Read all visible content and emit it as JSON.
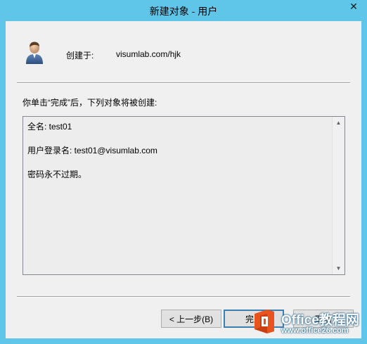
{
  "window": {
    "title": "新建对象 - 用户",
    "close_glyph": "✕"
  },
  "header": {
    "created_in_label": "创建于:",
    "created_in_value": "visumlab.com/hjk",
    "icon": "user-icon"
  },
  "summary": {
    "instruction": "你单击“完成”后，下列对象将被创建:",
    "lines": [
      "全名: test01",
      "用户登录名: test01@visumlab.com",
      "密码永不过期。"
    ]
  },
  "buttons": {
    "back": "< 上一步(B)",
    "finish": "完成",
    "cancel": "取消"
  },
  "watermark": {
    "name": "Office教程网",
    "url": "www.office26.com",
    "colors": {
      "logo_orange": "#e8541e",
      "logo_white": "#ffffff"
    }
  },
  "colors": {
    "frame": "#5fc6ea",
    "client": "#f0f0f0",
    "textbox": "#ededed"
  }
}
